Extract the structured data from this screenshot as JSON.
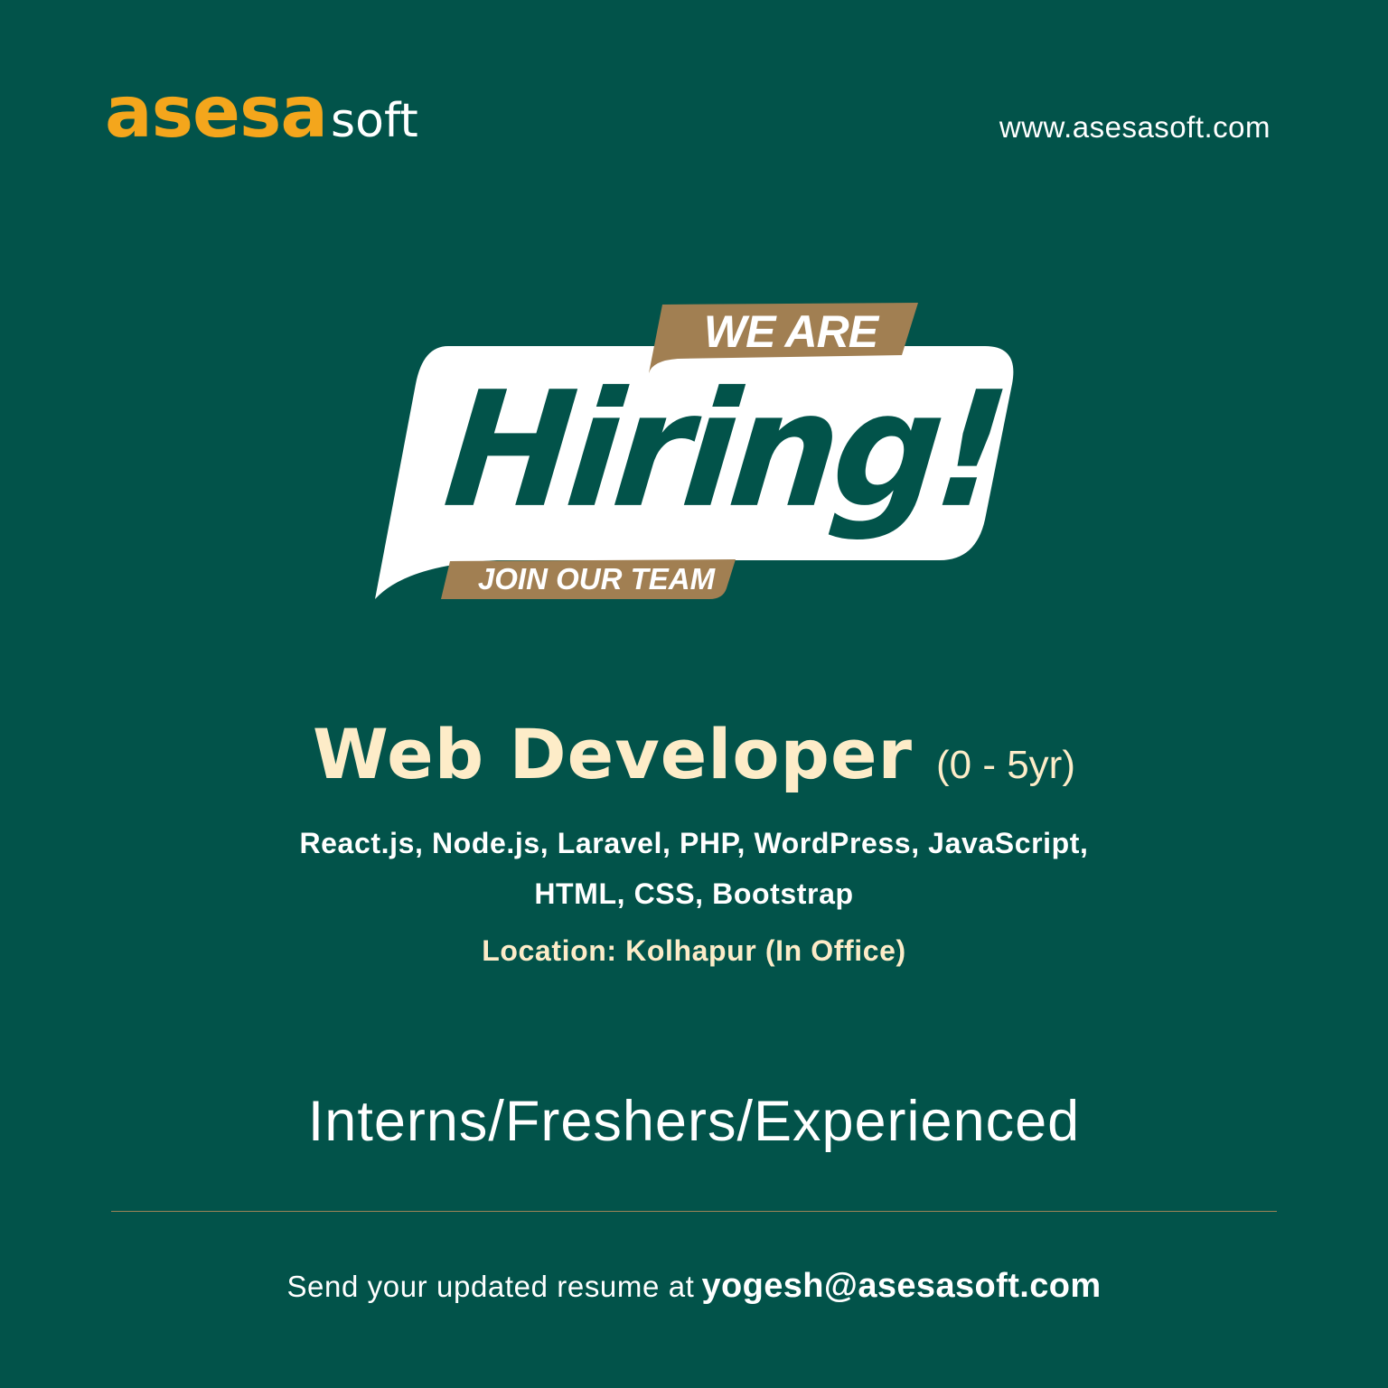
{
  "brand": {
    "logo_main": "asesa",
    "logo_sub": "soft",
    "website": "www.asesasoft.com",
    "colors": {
      "background": "#02534a",
      "accent_orange": "#f4a61c",
      "gold": "#a17f52",
      "cream": "#fdecc8"
    }
  },
  "banner": {
    "top_tag": "WE ARE",
    "headline": "Hiring!",
    "bottom_tag": "JOIN OUR TEAM"
  },
  "job": {
    "title": "Web Developer",
    "experience": "(0 - 5yr)",
    "skills_line1": "React.js, Node.js, Laravel, PHP, WordPress, JavaScript,",
    "skills_line2": "HTML, CSS, Bootstrap",
    "location": "Location: Kolhapur (In Office)"
  },
  "levels": "Interns/Freshers/Experienced",
  "contact": {
    "text": "Send your updated resume at",
    "email": "yogesh@asesasoft.com"
  }
}
